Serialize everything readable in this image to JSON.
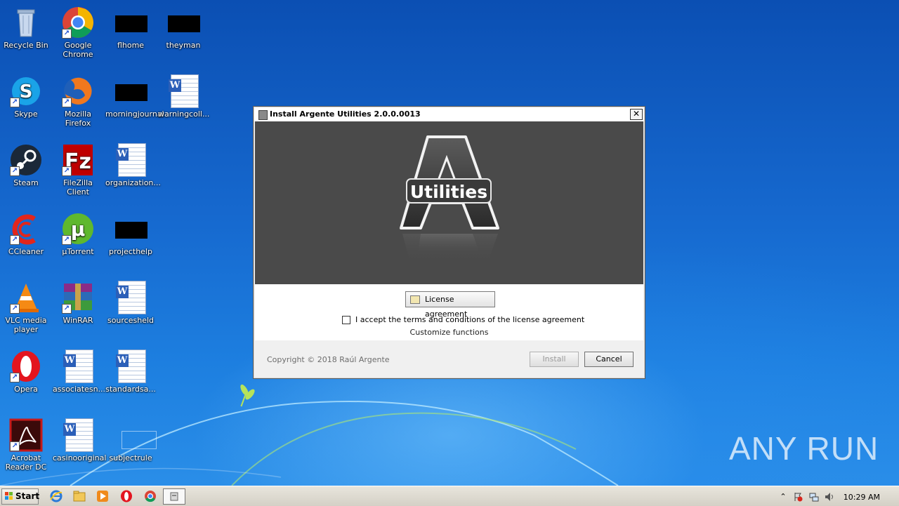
{
  "desktop": {
    "icons": [
      {
        "label": "Recycle Bin"
      },
      {
        "label": "Google Chrome"
      },
      {
        "label": "flhome"
      },
      {
        "label": "theyman"
      },
      {
        "label": "Skype"
      },
      {
        "label": "Mozilla Firefox"
      },
      {
        "label": "morningjournal"
      },
      {
        "label": "warningcoll..."
      },
      {
        "label": "Steam"
      },
      {
        "label": "FileZilla Client"
      },
      {
        "label": "organization..."
      },
      {
        "label": "CCleaner"
      },
      {
        "label": "µTorrent"
      },
      {
        "label": "projecthelp"
      },
      {
        "label": "VLC media player"
      },
      {
        "label": "WinRAR"
      },
      {
        "label": "sourcesheld"
      },
      {
        "label": "Opera"
      },
      {
        "label": "associatesn..."
      },
      {
        "label": "standardsa..."
      },
      {
        "label": "Acrobat Reader DC"
      },
      {
        "label": "casinooriginal"
      },
      {
        "label": "subjectrule"
      }
    ],
    "watermark": "ANY RUN"
  },
  "dialog": {
    "title": "Install Argente Utilities 2.0.0.0013",
    "close_glyph": "✕",
    "logo_text": "Utilities",
    "license_button": "License agreement",
    "accept_label": "I accept the terms and conditions of the license agreement",
    "accept_checked": false,
    "customize_link": "Customize functions",
    "copyright": "Copyright © 2018 Raúl Argente",
    "install_button": "Install",
    "install_enabled": false,
    "cancel_button": "Cancel"
  },
  "taskbar": {
    "start_label": "Start",
    "pinned": [
      "internet-explorer-icon",
      "explorer-icon",
      "media-player-icon",
      "opera-icon",
      "chrome-icon"
    ],
    "clock": "10:29 AM"
  },
  "colors": {
    "desktop_blue": "#1669cf",
    "banner_gray": "#4a4a4a"
  }
}
